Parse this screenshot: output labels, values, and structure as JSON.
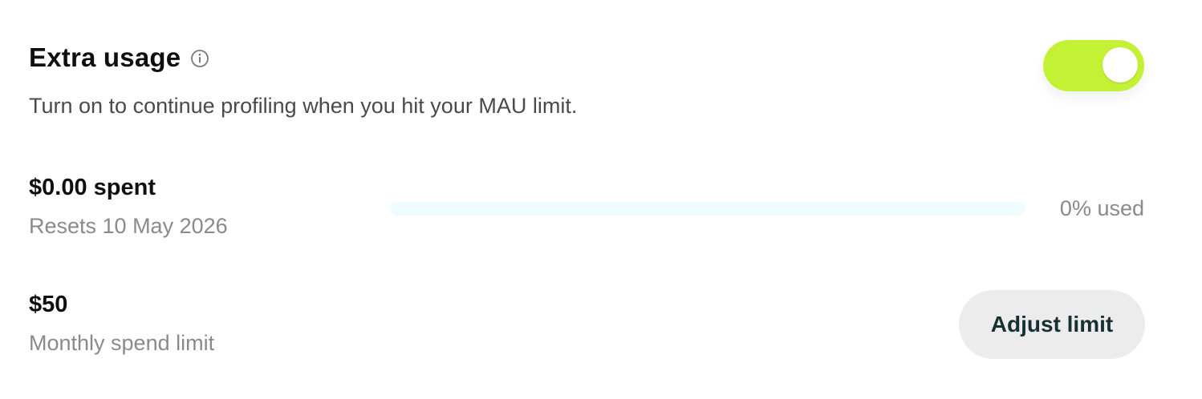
{
  "header": {
    "title": "Extra usage",
    "subtitle": "Turn on to continue profiling when you hit your MAU limit.",
    "info_icon": "info-icon"
  },
  "toggle": {
    "state": "on",
    "color": "#c2f233"
  },
  "spent": {
    "amount": "$0.00 spent",
    "resets": "Resets 10 May 2026",
    "used_percent": 0,
    "used_label": "0% used",
    "track_color": "#eefcff"
  },
  "limit": {
    "amount": "$50",
    "label": "Monthly spend limit",
    "adjust_label": "Adjust limit"
  }
}
